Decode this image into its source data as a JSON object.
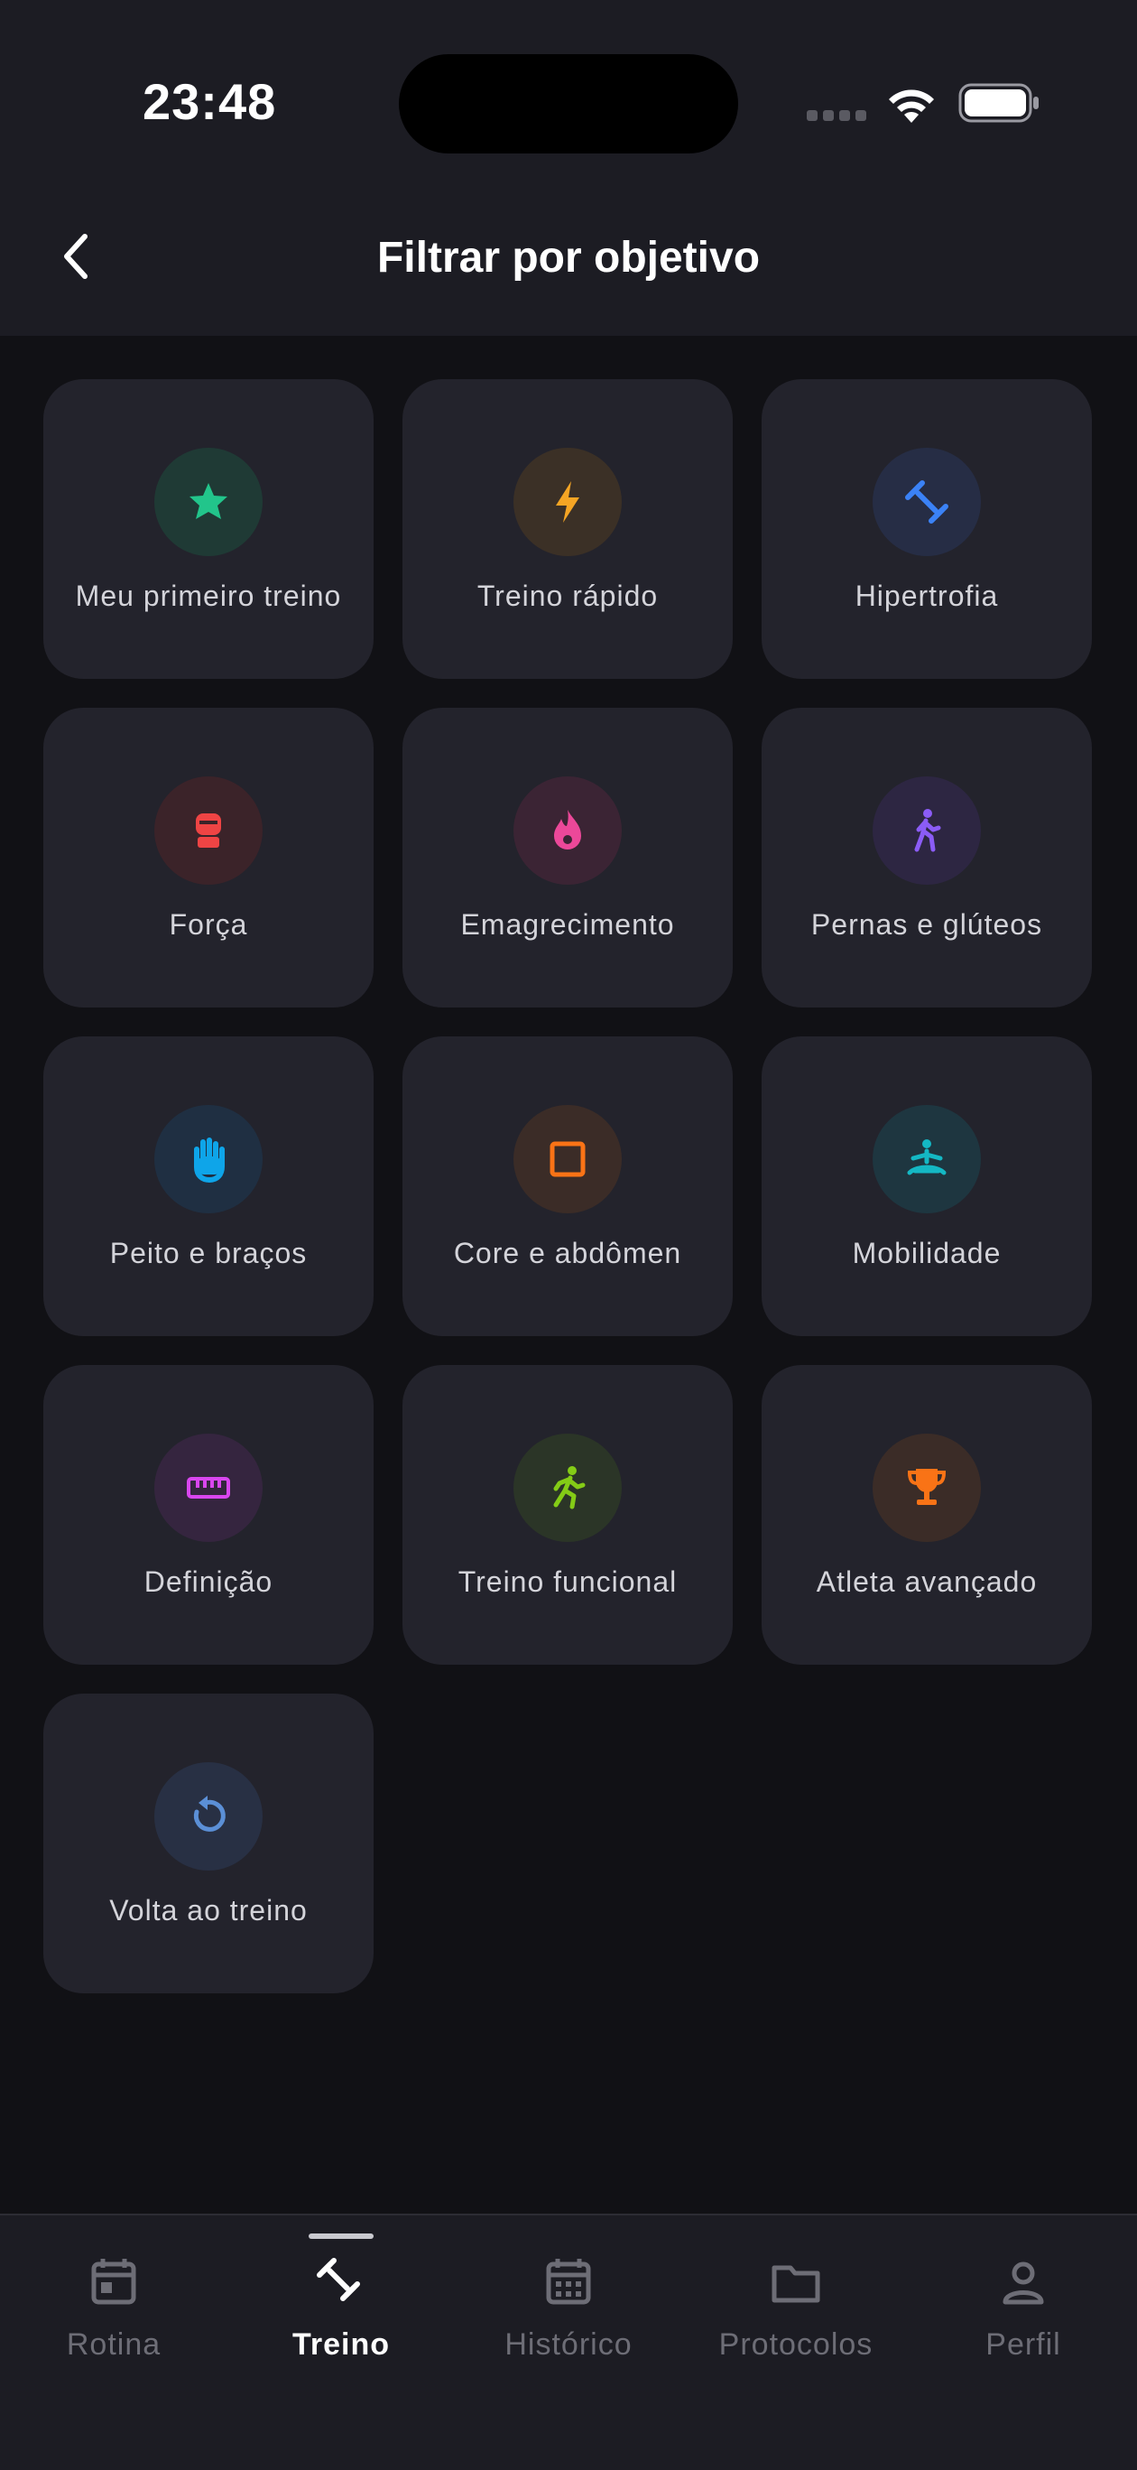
{
  "status_bar": {
    "time": "23:48"
  },
  "header": {
    "title": "Filtrar por objetivo"
  },
  "goals": [
    {
      "label": "Meu primeiro treino",
      "icon": "star-icon",
      "color": "#22c58b",
      "bg": "#1f3a35"
    },
    {
      "label": "Treino rápido",
      "icon": "lightning-icon",
      "color": "#f5a524",
      "bg": "#3b3026"
    },
    {
      "label": "Hipertrofia",
      "icon": "dumbbell-icon",
      "color": "#3b82f6",
      "bg": "#262d45"
    },
    {
      "label": "Força",
      "icon": "boxing-glove-icon",
      "color": "#ef4444",
      "bg": "#3b2329"
    },
    {
      "label": "Emagrecimento",
      "icon": "flame-icon",
      "color": "#ec4899",
      "bg": "#3b2434"
    },
    {
      "label": "Pernas e glúteos",
      "icon": "walking-person-icon",
      "color": "#8b5cf6",
      "bg": "#2d2642"
    },
    {
      "label": "Peito e braços",
      "icon": "hand-icon",
      "color": "#0ea5e9",
      "bg": "#1f2f42"
    },
    {
      "label": "Core e abdômen",
      "icon": "square-icon",
      "color": "#f97316",
      "bg": "#3b2c27"
    },
    {
      "label": "Mobilidade",
      "icon": "meditation-icon",
      "color": "#14b8c4",
      "bg": "#1e3640"
    },
    {
      "label": "Definição",
      "icon": "ruler-icon",
      "color": "#d946ef",
      "bg": "#35253f"
    },
    {
      "label": "Treino funcional",
      "icon": "running-person-icon",
      "color": "#84cc16",
      "bg": "#2b3527"
    },
    {
      "label": "Atleta avançado",
      "icon": "trophy-icon",
      "color": "#f97316",
      "bg": "#3b2c27"
    },
    {
      "label": "Volta ao treino",
      "icon": "restart-icon",
      "color": "#5b8fd6",
      "bg": "#283044"
    }
  ],
  "nav": {
    "items": [
      {
        "label": "Rotina",
        "icon": "calendar-icon",
        "active": false
      },
      {
        "label": "Treino",
        "icon": "dumbbell-icon",
        "active": true
      },
      {
        "label": "Histórico",
        "icon": "calendar-grid-icon",
        "active": false
      },
      {
        "label": "Protocolos",
        "icon": "folder-icon",
        "active": false
      },
      {
        "label": "Perfil",
        "icon": "user-icon",
        "active": false
      }
    ]
  }
}
